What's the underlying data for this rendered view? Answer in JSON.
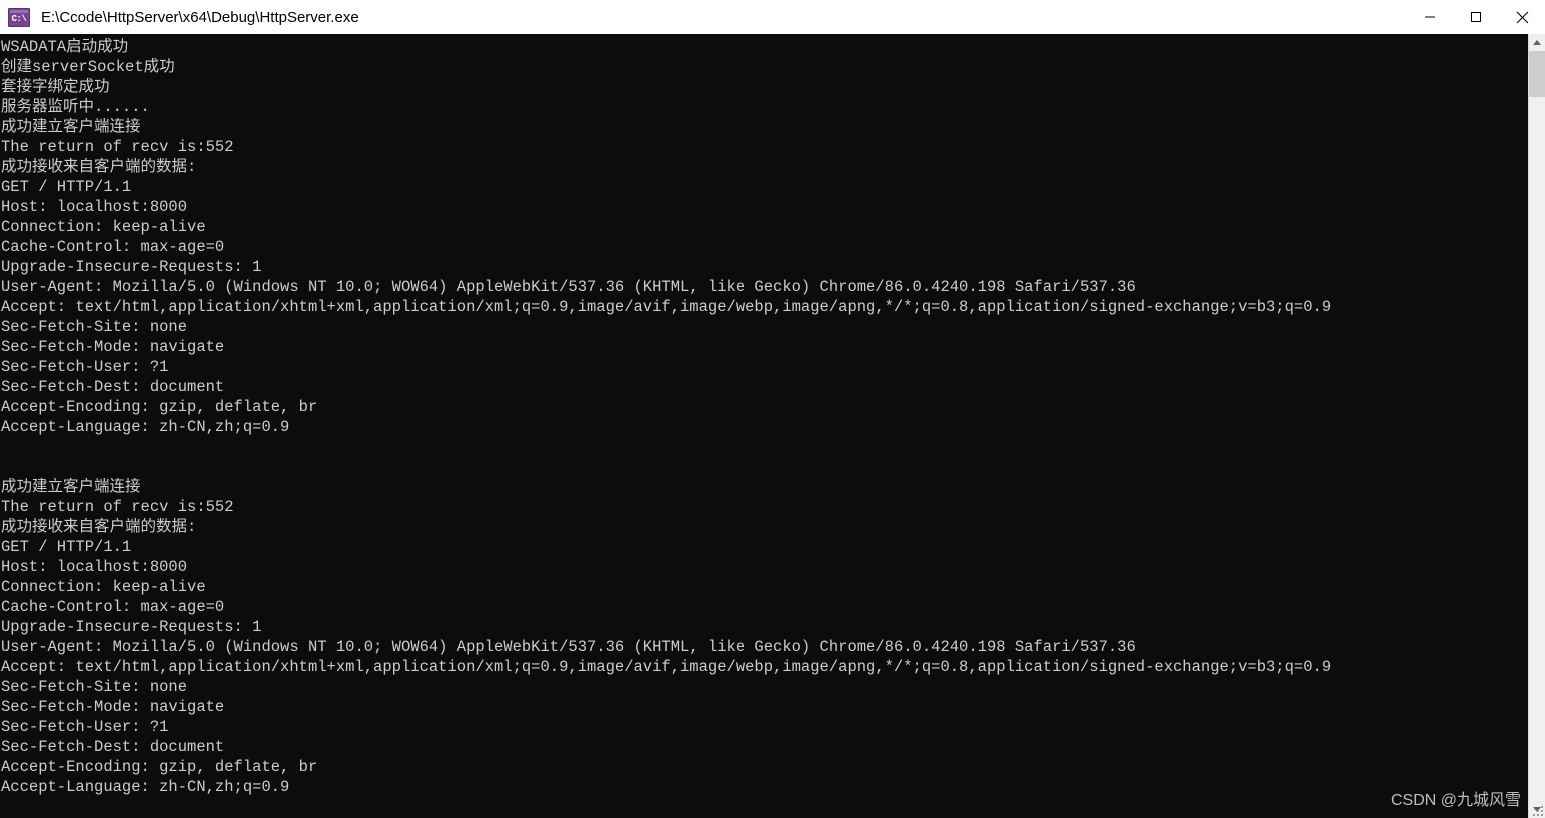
{
  "window": {
    "title": "E:\\Ccode\\HttpServer\\x64\\Debug\\HttpServer.exe",
    "icon_name": "console-app-icon",
    "icon_glyph": "C:\\",
    "background_color": "#0c0c0c",
    "titlebar_color": "#ffffff",
    "text_color": "#cccccc"
  },
  "controls": {
    "minimize_label": "Minimize",
    "maximize_label": "Maximize",
    "close_label": "Close"
  },
  "scrollbar": {
    "up_arrow_label": "Scroll up",
    "down_arrow_label": "Scroll down",
    "thumb_label": "Scroll thumb"
  },
  "watermark": {
    "text": "CSDN @九城风雪"
  },
  "console": {
    "lines": [
      "WSADATA启动成功",
      "创建serverSocket成功",
      "套接字绑定成功",
      "服务器监听中......",
      "成功建立客户端连接",
      "The return of recv is:552",
      "成功接收来自客户端的数据:",
      "GET / HTTP/1.1",
      "Host: localhost:8000",
      "Connection: keep-alive",
      "Cache-Control: max-age=0",
      "Upgrade-Insecure-Requests: 1",
      "User-Agent: Mozilla/5.0 (Windows NT 10.0; WOW64) AppleWebKit/537.36 (KHTML, like Gecko) Chrome/86.0.4240.198 Safari/537.36",
      "Accept: text/html,application/xhtml+xml,application/xml;q=0.9,image/avif,image/webp,image/apng,*/*;q=0.8,application/signed-exchange;v=b3;q=0.9",
      "Sec-Fetch-Site: none",
      "Sec-Fetch-Mode: navigate",
      "Sec-Fetch-User: ?1",
      "Sec-Fetch-Dest: document",
      "Accept-Encoding: gzip, deflate, br",
      "Accept-Language: zh-CN,zh;q=0.9",
      "",
      "",
      "成功建立客户端连接",
      "The return of recv is:552",
      "成功接收来自客户端的数据:",
      "GET / HTTP/1.1",
      "Host: localhost:8000",
      "Connection: keep-alive",
      "Cache-Control: max-age=0",
      "Upgrade-Insecure-Requests: 1",
      "User-Agent: Mozilla/5.0 (Windows NT 10.0; WOW64) AppleWebKit/537.36 (KHTML, like Gecko) Chrome/86.0.4240.198 Safari/537.36",
      "Accept: text/html,application/xhtml+xml,application/xml;q=0.9,image/avif,image/webp,image/apng,*/*;q=0.8,application/signed-exchange;v=b3;q=0.9",
      "Sec-Fetch-Site: none",
      "Sec-Fetch-Mode: navigate",
      "Sec-Fetch-User: ?1",
      "Sec-Fetch-Dest: document",
      "Accept-Encoding: gzip, deflate, br",
      "Accept-Language: zh-CN,zh;q=0.9"
    ]
  }
}
